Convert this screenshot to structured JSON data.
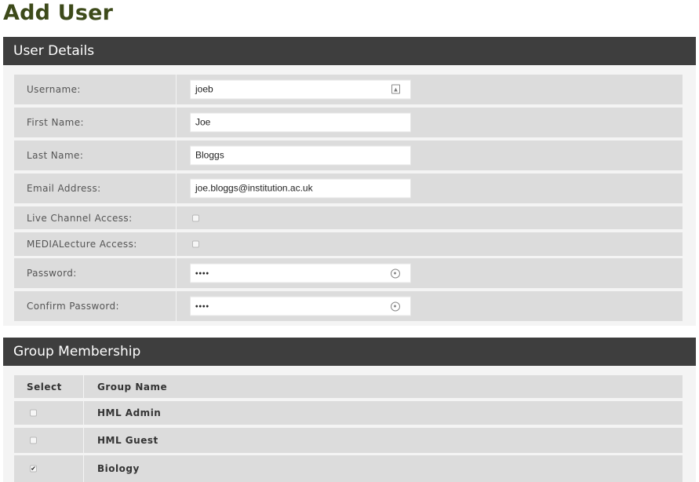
{
  "page": {
    "title": "Add User"
  },
  "details": {
    "header": "User Details",
    "username": {
      "label": "Username:",
      "value": "joeb"
    },
    "first_name": {
      "label": "First Name:",
      "value": "Joe"
    },
    "last_name": {
      "label": "Last Name:",
      "value": "Bloggs"
    },
    "email": {
      "label": "Email Address:",
      "value": "joe.bloggs@institution.ac.uk"
    },
    "live_channel": {
      "label": "Live Channel Access:",
      "checked": false
    },
    "medialecture": {
      "label": "MEDIALecture Access:",
      "checked": false
    },
    "password": {
      "label": "Password:",
      "value": "••••"
    },
    "confirm_password": {
      "label": "Confirm Password:",
      "value": "••••"
    }
  },
  "groups": {
    "header": "Group Membership",
    "columns": {
      "select": "Select",
      "name": "Group Name"
    },
    "rows": [
      {
        "name": "HML Admin",
        "checked": false,
        "mark": ""
      },
      {
        "name": "HML Guest",
        "checked": false,
        "mark": ""
      },
      {
        "name": "Biology",
        "checked": true,
        "mark": "✔"
      }
    ]
  },
  "icons": {
    "username_field": "contact-card-icon",
    "password_field": "password-key-icon"
  }
}
